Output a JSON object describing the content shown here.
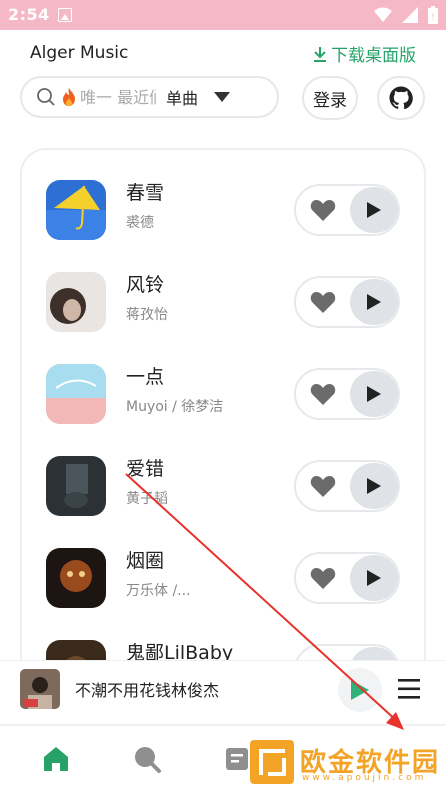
{
  "status_bar": {
    "time": "2:54"
  },
  "header": {
    "app_title": "Alger Music",
    "download_label": "下载桌面版"
  },
  "search": {
    "placeholder": "唯一 最近们",
    "type_label": "单曲"
  },
  "buttons": {
    "login_label": "登录"
  },
  "songs": [
    {
      "title": "春雪",
      "artist": "裘德"
    },
    {
      "title": "风铃",
      "artist": "蒋孜怡"
    },
    {
      "title": "一点",
      "artist": "Muyoi / 徐梦洁"
    },
    {
      "title": "爱错",
      "artist": "黄子韬"
    },
    {
      "title": "烟圈",
      "artist": "万乐体 /..."
    },
    {
      "title": "鬼鄙LilBaby",
      "artist": ""
    }
  ],
  "player": {
    "now_playing_title": "不潮不用花钱林俊杰"
  },
  "tabs": [
    {
      "name": "home",
      "icon": "home-icon",
      "active": true
    },
    {
      "name": "search",
      "icon": "search-icon",
      "active": false
    },
    {
      "name": "list",
      "icon": "list-icon",
      "active": false
    }
  ],
  "watermark": {
    "text": "欧金软件园",
    "sub": "www.apoujin.com"
  },
  "colors": {
    "status_bar": "#f5b8c6",
    "accent_green": "#27a36a",
    "annotation_arrow": "#e8322b",
    "watermark_orange": "#f3a326"
  }
}
